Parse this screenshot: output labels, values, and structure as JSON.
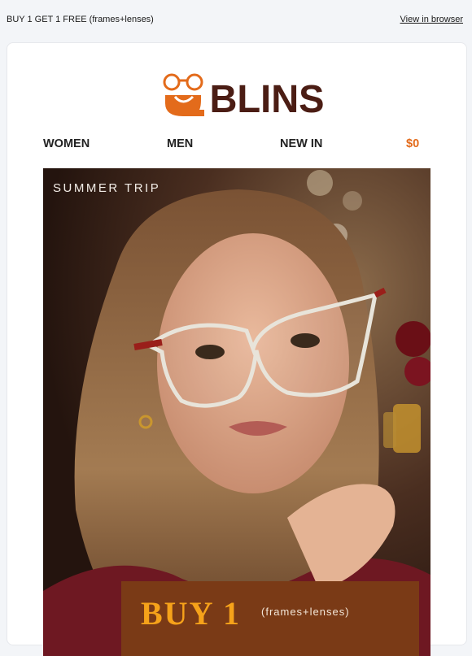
{
  "preheader": {
    "offer_text": "BUY 1 GET 1 FREE (frames+lenses)",
    "view_in_browser": "View in browser"
  },
  "logo": {
    "text": "BLINS",
    "colors": {
      "icon": "#e36b1b",
      "text": "#4b1d14"
    }
  },
  "nav": {
    "items": [
      "WOMEN",
      "MEN",
      "NEW IN"
    ],
    "cart_label": "$0",
    "cart_color": "#e36b1b"
  },
  "hero": {
    "label": "SUMMER TRIP",
    "promo": {
      "headline": "BUY 1",
      "subtext": "(frames+lenses)",
      "colors": {
        "panel": "#7a3a16",
        "headline": "#f6a21a"
      }
    }
  }
}
